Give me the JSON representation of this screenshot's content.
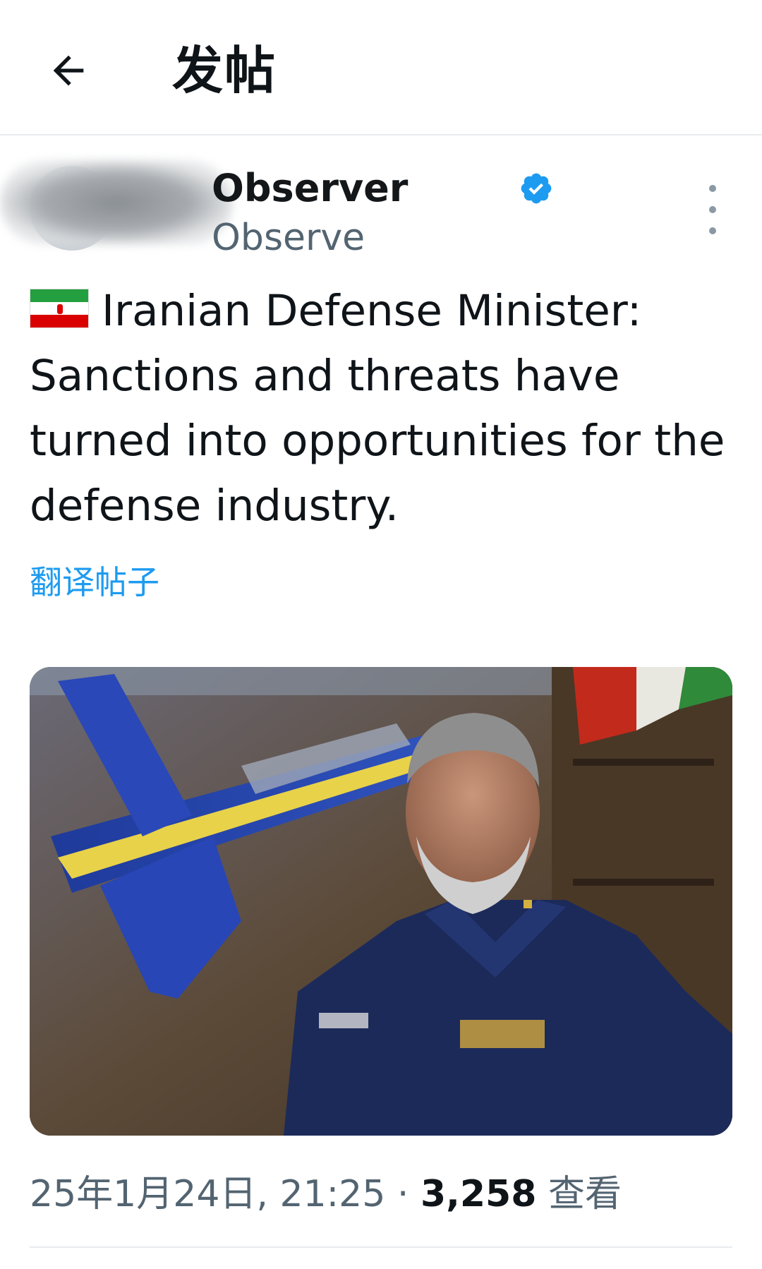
{
  "header": {
    "title": "发帖"
  },
  "author": {
    "display_name": "Observer",
    "handle": "Observe"
  },
  "post": {
    "text": "Iranian Defense Minister: Sanctions and threats have turned into opportunities for the defense industry.",
    "translate_label": "翻译帖子",
    "image": {
      "description": "Military officer in blue uniform with model jet aircraft and flag behind"
    }
  },
  "meta": {
    "date": "25年1月24日, 21:25",
    "separator": "·",
    "views": "3,258",
    "views_label": "查看"
  },
  "colors": {
    "accent": "#1d9bf0",
    "text": "#0f1419",
    "muted": "#536471",
    "verified": "#1d9bf0"
  }
}
